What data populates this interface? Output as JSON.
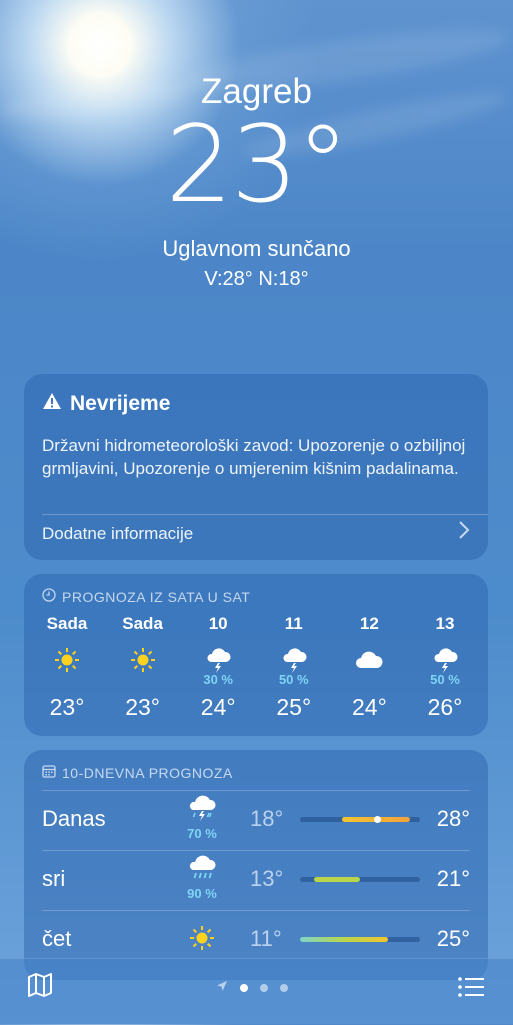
{
  "location": {
    "city": "Zagreb",
    "temperature": "23°",
    "condition": "Uglavnom sunčano",
    "high_low": "V:28°  N:18°"
  },
  "alert": {
    "icon": "warning-icon",
    "title": "Nevrijeme",
    "body": "Državni hidrometeorološki zavod: Upozorenje o ozbiljnoj grmljavini, Upozorenje o umjerenim kišnim padalinama.",
    "link_label": "Dodatne informacije"
  },
  "hourly": {
    "header": "PROGNOZA IZ SATA U SAT",
    "items": [
      {
        "label": "Sada",
        "icon": "sun-icon",
        "precip": "",
        "temp": "23°"
      },
      {
        "label": "Sada",
        "icon": "sun-icon",
        "precip": "",
        "temp": "23°"
      },
      {
        "label": "10",
        "icon": "thunderstorm-icon",
        "precip": "30 %",
        "temp": "24°"
      },
      {
        "label": "11",
        "icon": "thunderstorm-icon",
        "precip": "50 %",
        "temp": "25°"
      },
      {
        "label": "12",
        "icon": "cloud-icon",
        "precip": "",
        "temp": "24°"
      },
      {
        "label": "13",
        "icon": "thunderstorm-icon",
        "precip": "50 %",
        "temp": "26°"
      }
    ]
  },
  "daily": {
    "header": "10-DNEVNA PROGNOZA",
    "days": [
      {
        "name": "Danas",
        "icon": "thunderstorm-rain-icon",
        "precip": "70 %",
        "low": "18°",
        "high": "28°"
      },
      {
        "name": "sri",
        "icon": "rain-icon",
        "precip": "90 %",
        "low": "13°",
        "high": "21°"
      },
      {
        "name": "čet",
        "icon": "sun-icon",
        "precip": "",
        "low": "11°",
        "high": "25°"
      }
    ]
  },
  "tabbar": {
    "map_icon": "map-icon",
    "location_icon": "location-arrow-icon",
    "pages": 3,
    "active_page": 1,
    "list_icon": "list-icon"
  },
  "colors": {
    "precip": "#7fd4f5",
    "sun": "#ffd21f",
    "bar_warm": "#f2a23a",
    "bar_mild": "#b9d64a"
  }
}
